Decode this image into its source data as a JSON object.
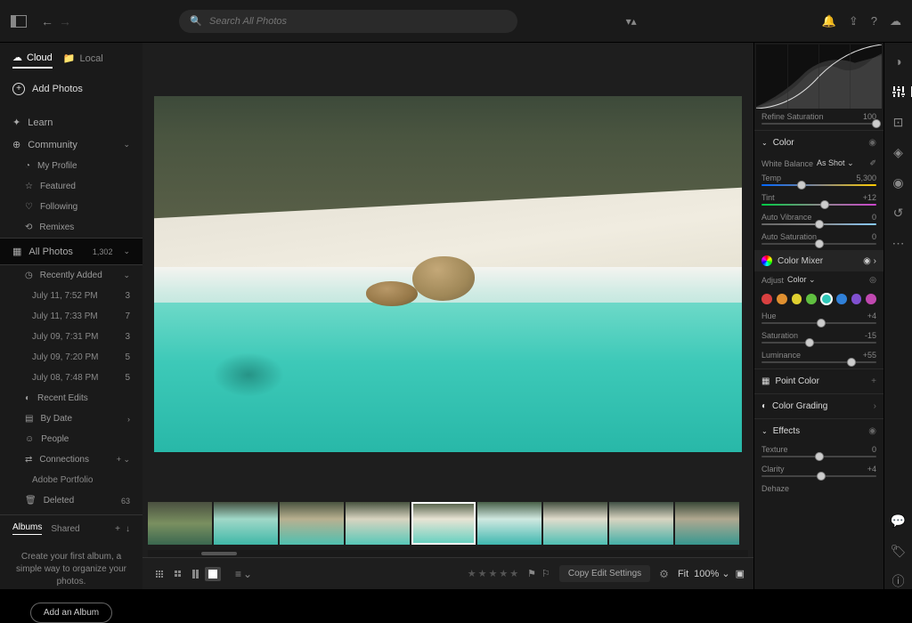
{
  "topbar": {
    "search_placeholder": "Search All Photos"
  },
  "sidebar": {
    "tabs": {
      "cloud": "Cloud",
      "local": "Local"
    },
    "add_photos": "Add Photos",
    "learn": "Learn",
    "community": "Community",
    "my_profile": "My Profile",
    "featured": "Featured",
    "following": "Following",
    "remixes": "Remixes",
    "all_photos": "All Photos",
    "all_photos_count": "1,302",
    "recently_added": "Recently Added",
    "dates": [
      {
        "label": "July 11, 7:52 PM",
        "count": "3"
      },
      {
        "label": "July 11, 7:33 PM",
        "count": "7"
      },
      {
        "label": "July 09, 7:31 PM",
        "count": "3"
      },
      {
        "label": "July 09, 7:20 PM",
        "count": "5"
      },
      {
        "label": "July 08, 7:48 PM",
        "count": "5"
      }
    ],
    "recent_edits": "Recent Edits",
    "by_date": "By Date",
    "people": "People",
    "connections": "Connections",
    "adobe_portfolio": "Adobe Portfolio",
    "deleted": "Deleted",
    "deleted_count": "63",
    "albums": "Albums",
    "shared": "Shared",
    "album_hint": "Create your first album, a simple way to organize your photos.",
    "add_album_btn": "Add an Album"
  },
  "bottombar": {
    "copy_edit": "Copy Edit Settings",
    "fit": "Fit",
    "zoom": "100%"
  },
  "right": {
    "refine_sat": {
      "label": "Refine Saturation",
      "value": "100",
      "pos": 100
    },
    "color_section": "Color",
    "white_balance_label": "White Balance",
    "white_balance_value": "As Shot",
    "temp": {
      "label": "Temp",
      "value": "5,300",
      "pos": 35
    },
    "tint": {
      "label": "Tint",
      "value": "+12",
      "pos": 55
    },
    "auto_vibrance": {
      "label": "Auto Vibrance",
      "value": "0",
      "pos": 50
    },
    "auto_saturation": {
      "label": "Auto Saturation",
      "value": "0",
      "pos": 50
    },
    "color_mixer": "Color Mixer",
    "adjust_label": "Adjust",
    "adjust_value": "Color",
    "colors": [
      {
        "hex": "#d94040"
      },
      {
        "hex": "#e09030"
      },
      {
        "hex": "#e0d030"
      },
      {
        "hex": "#60c040"
      },
      {
        "hex": "#30c8b8"
      },
      {
        "hex": "#3080d8"
      },
      {
        "hex": "#8050d0"
      },
      {
        "hex": "#c048b0"
      }
    ],
    "selected_color_index": 4,
    "hue": {
      "label": "Hue",
      "value": "+4",
      "pos": 52
    },
    "saturation": {
      "label": "Saturation",
      "value": "-15",
      "pos": 42
    },
    "luminance": {
      "label": "Luminance",
      "value": "+55",
      "pos": 78
    },
    "point_color": "Point Color",
    "point_color_badge": "+",
    "color_grading": "Color Grading",
    "effects": "Effects",
    "texture": {
      "label": "Texture",
      "value": "0",
      "pos": 50
    },
    "clarity": {
      "label": "Clarity",
      "value": "+4",
      "pos": 52
    },
    "dehaze": {
      "label": "Dehaze",
      "value": "",
      "pos": 50
    }
  }
}
